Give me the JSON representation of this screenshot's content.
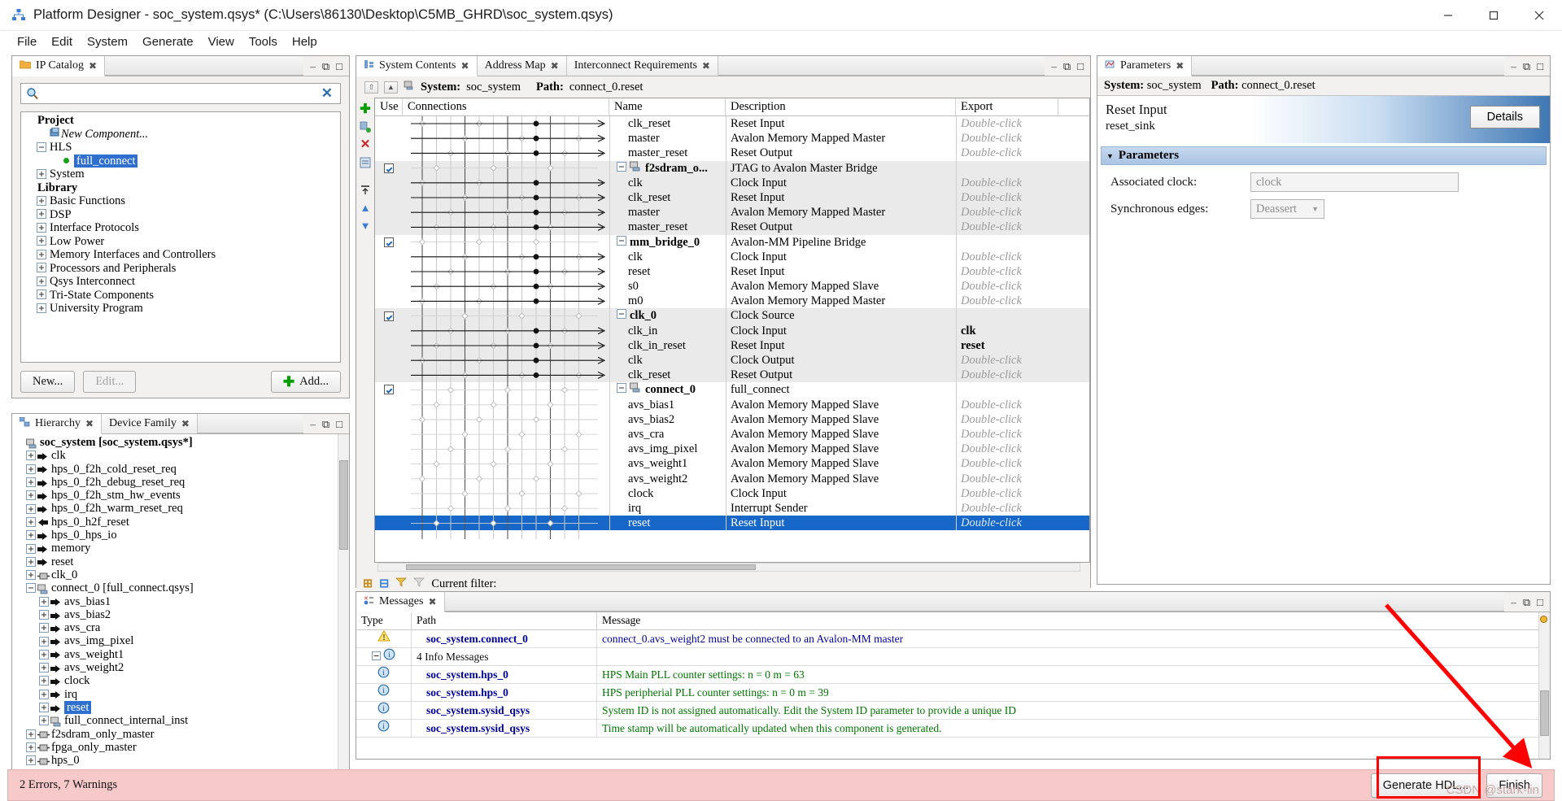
{
  "window": {
    "title": "Platform Designer - soc_system.qsys* (C:\\Users\\86130\\Desktop\\C5MB_GHRD\\soc_system.qsys)",
    "app_icon": "platform-designer-icon",
    "minimize": "minimize-icon",
    "maximize": "maximize-icon",
    "close": "close-icon"
  },
  "menubar": [
    "File",
    "Edit",
    "System",
    "Generate",
    "View",
    "Tools",
    "Help"
  ],
  "ip_catalog": {
    "tab_label": "IP Catalog",
    "search_placeholder": "",
    "search_value": "",
    "clear_icon": "clear-icon",
    "settings_icon": "gear-icon",
    "tree": [
      {
        "label": "Project",
        "level": 0,
        "style": "bold",
        "expander": "none"
      },
      {
        "label": "New Component...",
        "level": 1,
        "style": "italic",
        "expander": "none",
        "icon": "component-icon"
      },
      {
        "label": "HLS",
        "level": 1,
        "style": "plain",
        "expander": "minus"
      },
      {
        "label": "full_connect",
        "level": 2,
        "style": "selected",
        "expander": "none",
        "icon": "green-dot"
      },
      {
        "label": "System",
        "level": 1,
        "style": "plain",
        "expander": "plus"
      },
      {
        "label": "Library",
        "level": 0,
        "style": "bold",
        "expander": "none"
      },
      {
        "label": "Basic Functions",
        "level": 1,
        "style": "plain",
        "expander": "plus"
      },
      {
        "label": "DSP",
        "level": 1,
        "style": "plain",
        "expander": "plus"
      },
      {
        "label": "Interface Protocols",
        "level": 1,
        "style": "plain",
        "expander": "plus"
      },
      {
        "label": "Low Power",
        "level": 1,
        "style": "plain",
        "expander": "plus"
      },
      {
        "label": "Memory Interfaces and Controllers",
        "level": 1,
        "style": "plain",
        "expander": "plus"
      },
      {
        "label": "Processors and Peripherals",
        "level": 1,
        "style": "plain",
        "expander": "plus"
      },
      {
        "label": "Qsys Interconnect",
        "level": 1,
        "style": "plain",
        "expander": "plus"
      },
      {
        "label": "Tri-State Components",
        "level": 1,
        "style": "plain",
        "expander": "plus"
      },
      {
        "label": "University Program",
        "level": 1,
        "style": "plain",
        "expander": "plus"
      }
    ],
    "buttons": {
      "new": "New...",
      "edit": "Edit...",
      "add": "Add..."
    }
  },
  "hierarchy": {
    "tabs": [
      "Hierarchy",
      "Device Family"
    ],
    "active_tab": "Hierarchy",
    "rows": [
      {
        "label": "soc_system [soc_system.qsys*]",
        "level": 0,
        "expander": "none",
        "icon": "system-icon",
        "style": "bold"
      },
      {
        "label": "clk",
        "level": 1,
        "expander": "plus",
        "icon": "port-right"
      },
      {
        "label": "hps_0_f2h_cold_reset_req",
        "level": 1,
        "expander": "plus",
        "icon": "port-right"
      },
      {
        "label": "hps_0_f2h_debug_reset_req",
        "level": 1,
        "expander": "plus",
        "icon": "port-right"
      },
      {
        "label": "hps_0_f2h_stm_hw_events",
        "level": 1,
        "expander": "plus",
        "icon": "port-right"
      },
      {
        "label": "hps_0_f2h_warm_reset_req",
        "level": 1,
        "expander": "plus",
        "icon": "port-right"
      },
      {
        "label": "hps_0_h2f_reset",
        "level": 1,
        "expander": "plus",
        "icon": "port-left"
      },
      {
        "label": "hps_0_hps_io",
        "level": 1,
        "expander": "plus",
        "icon": "port-right"
      },
      {
        "label": "memory",
        "level": 1,
        "expander": "plus",
        "icon": "port-right"
      },
      {
        "label": "reset",
        "level": 1,
        "expander": "plus",
        "icon": "port-right"
      },
      {
        "label": "clk_0",
        "level": 1,
        "expander": "plus",
        "icon": "module-icon"
      },
      {
        "label": "connect_0 [full_connect.qsys]",
        "level": 1,
        "expander": "minus",
        "icon": "system-icon"
      },
      {
        "label": "avs_bias1",
        "level": 2,
        "expander": "plus",
        "icon": "port-right"
      },
      {
        "label": "avs_bias2",
        "level": 2,
        "expander": "plus",
        "icon": "port-right"
      },
      {
        "label": "avs_cra",
        "level": 2,
        "expander": "plus",
        "icon": "port-right"
      },
      {
        "label": "avs_img_pixel",
        "level": 2,
        "expander": "plus",
        "icon": "port-right"
      },
      {
        "label": "avs_weight1",
        "level": 2,
        "expander": "plus",
        "icon": "port-right"
      },
      {
        "label": "avs_weight2",
        "level": 2,
        "expander": "plus",
        "icon": "port-right"
      },
      {
        "label": "clock",
        "level": 2,
        "expander": "plus",
        "icon": "port-right"
      },
      {
        "label": "irq",
        "level": 2,
        "expander": "plus",
        "icon": "port-right"
      },
      {
        "label": "reset",
        "level": 2,
        "expander": "plus",
        "icon": "port-right",
        "style": "selected"
      },
      {
        "label": "full_connect_internal_inst",
        "level": 2,
        "expander": "plus",
        "icon": "system-icon"
      },
      {
        "label": "f2sdram_only_master",
        "level": 1,
        "expander": "plus",
        "icon": "module-icon"
      },
      {
        "label": "fpga_only_master",
        "level": 1,
        "expander": "plus",
        "icon": "module-icon"
      },
      {
        "label": "hps_0",
        "level": 1,
        "expander": "plus",
        "icon": "module-icon"
      }
    ]
  },
  "system_contents": {
    "tabs": [
      "System Contents",
      "Address Map",
      "Interconnect Requirements"
    ],
    "active_tab": "System Contents",
    "system_label": "System:",
    "system_value": "soc_system",
    "path_label": "Path:",
    "path_value": "connect_0.reset",
    "columns": [
      "Use",
      "Connections",
      "Name",
      "Description",
      "Export"
    ],
    "filter_label": "Current filter:",
    "filter_value": "",
    "rows": [
      {
        "use": "",
        "name": "clk_reset",
        "desc": "Reset Input",
        "export": "Double-click",
        "indent": 1,
        "alt": false
      },
      {
        "use": "",
        "name": "master",
        "desc": "Avalon Memory Mapped Master",
        "export": "Double-click",
        "indent": 1,
        "alt": false
      },
      {
        "use": "",
        "name": "master_reset",
        "desc": "Reset Output",
        "export": "Double-click",
        "indent": 1,
        "alt": false
      },
      {
        "use": "checked",
        "name": "f2sdram_o...",
        "desc": "JTAG to Avalon Master Bridge",
        "export": "",
        "indent": 0,
        "alt": true,
        "parent": true,
        "icon": "system-icon"
      },
      {
        "use": "",
        "name": "clk",
        "desc": "Clock Input",
        "export": "Double-click",
        "indent": 1,
        "alt": true
      },
      {
        "use": "",
        "name": "clk_reset",
        "desc": "Reset Input",
        "export": "Double-click",
        "indent": 1,
        "alt": true
      },
      {
        "use": "",
        "name": "master",
        "desc": "Avalon Memory Mapped Master",
        "export": "Double-click",
        "indent": 1,
        "alt": true
      },
      {
        "use": "",
        "name": "master_reset",
        "desc": "Reset Output",
        "export": "Double-click",
        "indent": 1,
        "alt": true
      },
      {
        "use": "checked",
        "name": "mm_bridge_0",
        "desc": "Avalon-MM Pipeline Bridge",
        "export": "",
        "indent": 0,
        "alt": false,
        "parent": true
      },
      {
        "use": "",
        "name": "clk",
        "desc": "Clock Input",
        "export": "Double-click",
        "indent": 1,
        "alt": false
      },
      {
        "use": "",
        "name": "reset",
        "desc": "Reset Input",
        "export": "Double-click",
        "indent": 1,
        "alt": false
      },
      {
        "use": "",
        "name": "s0",
        "desc": "Avalon Memory Mapped Slave",
        "export": "Double-click",
        "indent": 1,
        "alt": false
      },
      {
        "use": "",
        "name": "m0",
        "desc": "Avalon Memory Mapped Master",
        "export": "Double-click",
        "indent": 1,
        "alt": false
      },
      {
        "use": "checked",
        "name": "clk_0",
        "desc": "Clock Source",
        "export": "",
        "indent": 0,
        "alt": true,
        "parent": true
      },
      {
        "use": "",
        "name": "clk_in",
        "desc": "Clock Input",
        "export": "clk",
        "export_bold": true,
        "indent": 1,
        "alt": true
      },
      {
        "use": "",
        "name": "clk_in_reset",
        "desc": "Reset Input",
        "export": "reset",
        "export_bold": true,
        "indent": 1,
        "alt": true
      },
      {
        "use": "",
        "name": "clk",
        "desc": "Clock Output",
        "export": "Double-click",
        "indent": 1,
        "alt": true
      },
      {
        "use": "",
        "name": "clk_reset",
        "desc": "Reset Output",
        "export": "Double-click",
        "indent": 1,
        "alt": true
      },
      {
        "use": "checked",
        "name": "connect_0",
        "desc": "full_connect",
        "export": "",
        "indent": 0,
        "alt": false,
        "parent": true,
        "icon": "system-icon"
      },
      {
        "use": "",
        "name": "avs_bias1",
        "desc": "Avalon Memory Mapped Slave",
        "export": "Double-click",
        "indent": 1,
        "alt": false
      },
      {
        "use": "",
        "name": "avs_bias2",
        "desc": "Avalon Memory Mapped Slave",
        "export": "Double-click",
        "indent": 1,
        "alt": false
      },
      {
        "use": "",
        "name": "avs_cra",
        "desc": "Avalon Memory Mapped Slave",
        "export": "Double-click",
        "indent": 1,
        "alt": false
      },
      {
        "use": "",
        "name": "avs_img_pixel",
        "desc": "Avalon Memory Mapped Slave",
        "export": "Double-click",
        "indent": 1,
        "alt": false
      },
      {
        "use": "",
        "name": "avs_weight1",
        "desc": "Avalon Memory Mapped Slave",
        "export": "Double-click",
        "indent": 1,
        "alt": false
      },
      {
        "use": "",
        "name": "avs_weight2",
        "desc": "Avalon Memory Mapped Slave",
        "export": "Double-click",
        "indent": 1,
        "alt": false
      },
      {
        "use": "",
        "name": "clock",
        "desc": "Clock Input",
        "export": "Double-click",
        "indent": 1,
        "alt": false
      },
      {
        "use": "",
        "name": "irq",
        "desc": "Interrupt Sender",
        "export": "Double-click",
        "indent": 1,
        "alt": false
      },
      {
        "use": "",
        "name": "reset",
        "desc": "Reset Input",
        "export": "Double-click",
        "indent": 1,
        "alt": false,
        "selected": true
      }
    ]
  },
  "messages": {
    "tab_label": "Messages",
    "columns": [
      "Type",
      "Path",
      "Message"
    ],
    "rows": [
      {
        "type": "warning",
        "path": "soc_system.connect_0",
        "message": "connect_0.avs_weight2 must be connected to an Avalon-MM master",
        "msg_color": "blue",
        "group": false
      },
      {
        "type": "info",
        "path": "",
        "message": "4 Info Messages",
        "msg_color": "black",
        "group": true,
        "group_label": "4 Info Messages"
      },
      {
        "type": "info",
        "path": "soc_system.hps_0",
        "message": "HPS Main PLL counter settings: n = 0 m = 63",
        "msg_color": "green",
        "group": false
      },
      {
        "type": "info",
        "path": "soc_system.hps_0",
        "message": "HPS peripherial PLL counter settings: n = 0 m = 39",
        "msg_color": "green",
        "group": false
      },
      {
        "type": "info",
        "path": "soc_system.sysid_qsys",
        "message": "System ID is not assigned automatically. Edit the System ID parameter to provide a unique ID",
        "msg_color": "green",
        "group": false
      },
      {
        "type": "info",
        "path": "soc_system.sysid_qsys",
        "message": "Time stamp will be automatically updated when this component is generated.",
        "msg_color": "green",
        "group": false
      }
    ]
  },
  "parameters": {
    "tab_label": "Parameters",
    "system_label": "System:",
    "system_value": "soc_system",
    "path_label": "Path:",
    "path_value": "connect_0.reset",
    "hero_title": "Reset Input",
    "hero_subtitle": "reset_sink",
    "details_button": "Details",
    "section_title": "Parameters",
    "fields": [
      {
        "label": "Associated clock:",
        "value": "clock",
        "type": "text"
      },
      {
        "label": "Synchronous edges:",
        "value": "Deassert",
        "type": "select"
      }
    ]
  },
  "statusbar": {
    "text": "2 Errors, 7 Warnings",
    "generate_button": "Generate HDL...",
    "finish_button": "Finish",
    "watermark": "CSDN @stark-lin"
  },
  "colors": {
    "accent_blue": "#1667c8",
    "selection_blue": "#2f6fd0",
    "error_bg": "#f7c9c9",
    "highlight_red": "#ff0000",
    "info_green": "#007500",
    "msg_blue": "#00009c"
  }
}
